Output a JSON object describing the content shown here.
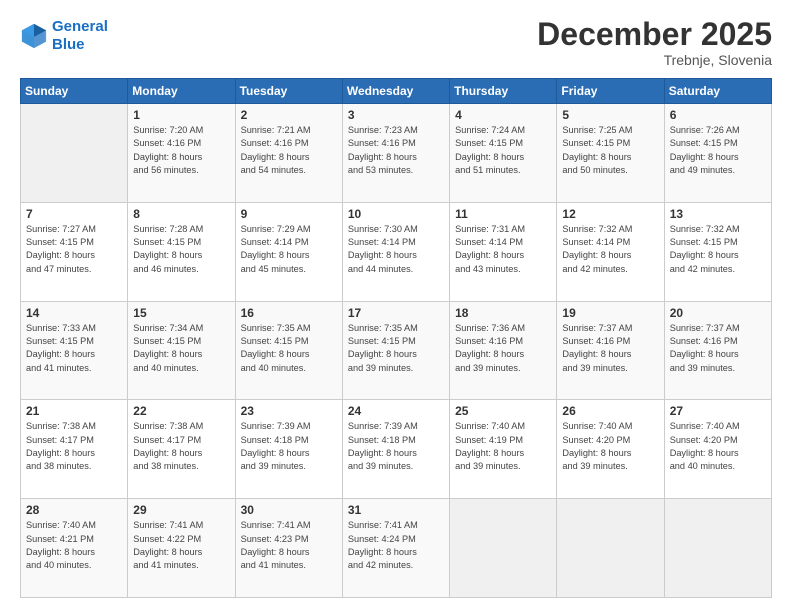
{
  "header": {
    "logo_line1": "General",
    "logo_line2": "Blue",
    "month": "December 2025",
    "location": "Trebnje, Slovenia"
  },
  "weekdays": [
    "Sunday",
    "Monday",
    "Tuesday",
    "Wednesday",
    "Thursday",
    "Friday",
    "Saturday"
  ],
  "weeks": [
    [
      {
        "day": "",
        "info": ""
      },
      {
        "day": "1",
        "info": "Sunrise: 7:20 AM\nSunset: 4:16 PM\nDaylight: 8 hours\nand 56 minutes."
      },
      {
        "day": "2",
        "info": "Sunrise: 7:21 AM\nSunset: 4:16 PM\nDaylight: 8 hours\nand 54 minutes."
      },
      {
        "day": "3",
        "info": "Sunrise: 7:23 AM\nSunset: 4:16 PM\nDaylight: 8 hours\nand 53 minutes."
      },
      {
        "day": "4",
        "info": "Sunrise: 7:24 AM\nSunset: 4:15 PM\nDaylight: 8 hours\nand 51 minutes."
      },
      {
        "day": "5",
        "info": "Sunrise: 7:25 AM\nSunset: 4:15 PM\nDaylight: 8 hours\nand 50 minutes."
      },
      {
        "day": "6",
        "info": "Sunrise: 7:26 AM\nSunset: 4:15 PM\nDaylight: 8 hours\nand 49 minutes."
      }
    ],
    [
      {
        "day": "7",
        "info": "Sunrise: 7:27 AM\nSunset: 4:15 PM\nDaylight: 8 hours\nand 47 minutes."
      },
      {
        "day": "8",
        "info": "Sunrise: 7:28 AM\nSunset: 4:15 PM\nDaylight: 8 hours\nand 46 minutes."
      },
      {
        "day": "9",
        "info": "Sunrise: 7:29 AM\nSunset: 4:14 PM\nDaylight: 8 hours\nand 45 minutes."
      },
      {
        "day": "10",
        "info": "Sunrise: 7:30 AM\nSunset: 4:14 PM\nDaylight: 8 hours\nand 44 minutes."
      },
      {
        "day": "11",
        "info": "Sunrise: 7:31 AM\nSunset: 4:14 PM\nDaylight: 8 hours\nand 43 minutes."
      },
      {
        "day": "12",
        "info": "Sunrise: 7:32 AM\nSunset: 4:14 PM\nDaylight: 8 hours\nand 42 minutes."
      },
      {
        "day": "13",
        "info": "Sunrise: 7:32 AM\nSunset: 4:15 PM\nDaylight: 8 hours\nand 42 minutes."
      }
    ],
    [
      {
        "day": "14",
        "info": "Sunrise: 7:33 AM\nSunset: 4:15 PM\nDaylight: 8 hours\nand 41 minutes."
      },
      {
        "day": "15",
        "info": "Sunrise: 7:34 AM\nSunset: 4:15 PM\nDaylight: 8 hours\nand 40 minutes."
      },
      {
        "day": "16",
        "info": "Sunrise: 7:35 AM\nSunset: 4:15 PM\nDaylight: 8 hours\nand 40 minutes."
      },
      {
        "day": "17",
        "info": "Sunrise: 7:35 AM\nSunset: 4:15 PM\nDaylight: 8 hours\nand 39 minutes."
      },
      {
        "day": "18",
        "info": "Sunrise: 7:36 AM\nSunset: 4:16 PM\nDaylight: 8 hours\nand 39 minutes."
      },
      {
        "day": "19",
        "info": "Sunrise: 7:37 AM\nSunset: 4:16 PM\nDaylight: 8 hours\nand 39 minutes."
      },
      {
        "day": "20",
        "info": "Sunrise: 7:37 AM\nSunset: 4:16 PM\nDaylight: 8 hours\nand 39 minutes."
      }
    ],
    [
      {
        "day": "21",
        "info": "Sunrise: 7:38 AM\nSunset: 4:17 PM\nDaylight: 8 hours\nand 38 minutes."
      },
      {
        "day": "22",
        "info": "Sunrise: 7:38 AM\nSunset: 4:17 PM\nDaylight: 8 hours\nand 38 minutes."
      },
      {
        "day": "23",
        "info": "Sunrise: 7:39 AM\nSunset: 4:18 PM\nDaylight: 8 hours\nand 39 minutes."
      },
      {
        "day": "24",
        "info": "Sunrise: 7:39 AM\nSunset: 4:18 PM\nDaylight: 8 hours\nand 39 minutes."
      },
      {
        "day": "25",
        "info": "Sunrise: 7:40 AM\nSunset: 4:19 PM\nDaylight: 8 hours\nand 39 minutes."
      },
      {
        "day": "26",
        "info": "Sunrise: 7:40 AM\nSunset: 4:20 PM\nDaylight: 8 hours\nand 39 minutes."
      },
      {
        "day": "27",
        "info": "Sunrise: 7:40 AM\nSunset: 4:20 PM\nDaylight: 8 hours\nand 40 minutes."
      }
    ],
    [
      {
        "day": "28",
        "info": "Sunrise: 7:40 AM\nSunset: 4:21 PM\nDaylight: 8 hours\nand 40 minutes."
      },
      {
        "day": "29",
        "info": "Sunrise: 7:41 AM\nSunset: 4:22 PM\nDaylight: 8 hours\nand 41 minutes."
      },
      {
        "day": "30",
        "info": "Sunrise: 7:41 AM\nSunset: 4:23 PM\nDaylight: 8 hours\nand 41 minutes."
      },
      {
        "day": "31",
        "info": "Sunrise: 7:41 AM\nSunset: 4:24 PM\nDaylight: 8 hours\nand 42 minutes."
      },
      {
        "day": "",
        "info": ""
      },
      {
        "day": "",
        "info": ""
      },
      {
        "day": "",
        "info": ""
      }
    ]
  ]
}
